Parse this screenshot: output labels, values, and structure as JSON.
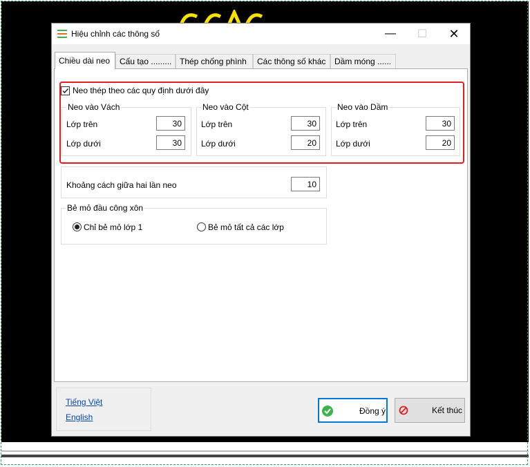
{
  "dialog": {
    "title": "Hiệu chỉnh các thông số",
    "tabs": [
      "Chiều dài neo",
      "Cấu tạo .........",
      "Thép chống phình",
      "Các thông số khác",
      "Dầm móng ......"
    ],
    "neo": {
      "checkbox_label": "Neo thép theo các quy định dưới đây",
      "checked": true,
      "groups": [
        {
          "title": "Neo vào Vách",
          "top_label": "Lớp trên",
          "top_value": "30",
          "bottom_label": "Lớp dưới",
          "bottom_value": "30"
        },
        {
          "title": "Neo vào Cột",
          "top_label": "Lớp trên",
          "top_value": "30",
          "bottom_label": "Lớp dưới",
          "bottom_value": "20"
        },
        {
          "title": "Neo vào Dầm",
          "top_label": "Lớp trên",
          "top_value": "30",
          "bottom_label": "Lớp dưới",
          "bottom_value": "20"
        }
      ]
    },
    "spacing": {
      "label": "Khoảng cách giữa hai lần neo",
      "value": "10"
    },
    "cantilever": {
      "title": "Bẻ mỏ đầu công xôn",
      "option1": "Chỉ bẻ mỏ lớp 1",
      "option2": "Bẻ mỏ tất cả các lớp",
      "selected": 1
    },
    "languages": [
      "Tiếng Việt",
      "English"
    ],
    "ok_label": "Đồng ý",
    "cancel_label": "Kết thúc",
    "colors": {
      "accent": "#0078d7",
      "highlight_border": "#e01e1e",
      "ok_icon": "#3cb44b",
      "cancel_icon": "#e01e1e",
      "background_text": "#f5e000"
    }
  }
}
